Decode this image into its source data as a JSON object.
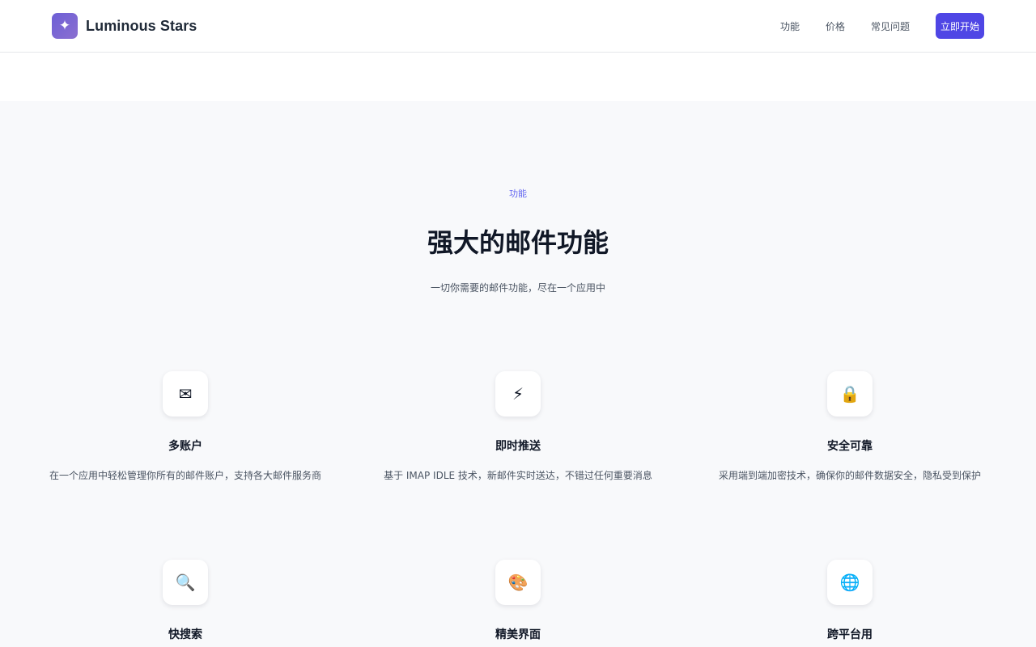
{
  "brand": {
    "logo_glyph": "✦",
    "name": "Luminous Stars"
  },
  "nav": {
    "links": [
      "功能",
      "价格",
      "常见问题"
    ],
    "cta_label": "立即开始"
  },
  "features_section": {
    "eyebrow": "功能",
    "title": "强大的邮件功能",
    "subtitle": "一切你需要的邮件功能，尽在一个应用中",
    "items": [
      {
        "icon_name": "envelope-icon",
        "icon": "✉",
        "title": "多账户",
        "description": "在一个应用中轻松管理你所有的邮件账户，支持各大邮件服务商"
      },
      {
        "icon_name": "lightning-icon",
        "icon": "⚡",
        "title": "即时推送",
        "description": "基于 IMAP IDLE 技术，新邮件实时送达，不错过任何重要消息"
      },
      {
        "icon_name": "lock-icon",
        "icon": "🔒",
        "title": "安全可靠",
        "description": "采用端到端加密技术，确保你的邮件数据安全，隐私受到保护"
      },
      {
        "icon_name": "search-icon",
        "icon": "🔍",
        "title": "快搜索",
        "description": ""
      },
      {
        "icon_name": "palette-icon",
        "icon": "🎨",
        "title": "精美界面",
        "description": ""
      },
      {
        "icon_name": "globe-icon",
        "icon": "🌐",
        "title": "跨平台用",
        "description": ""
      }
    ]
  },
  "colors": {
    "accent": "#4f46e5",
    "eyebrow": "#6366f1",
    "section_bg": "#f8f9fb",
    "logo_gradient_start": "#6d5fd6",
    "logo_gradient_end": "#8b6fd0"
  }
}
